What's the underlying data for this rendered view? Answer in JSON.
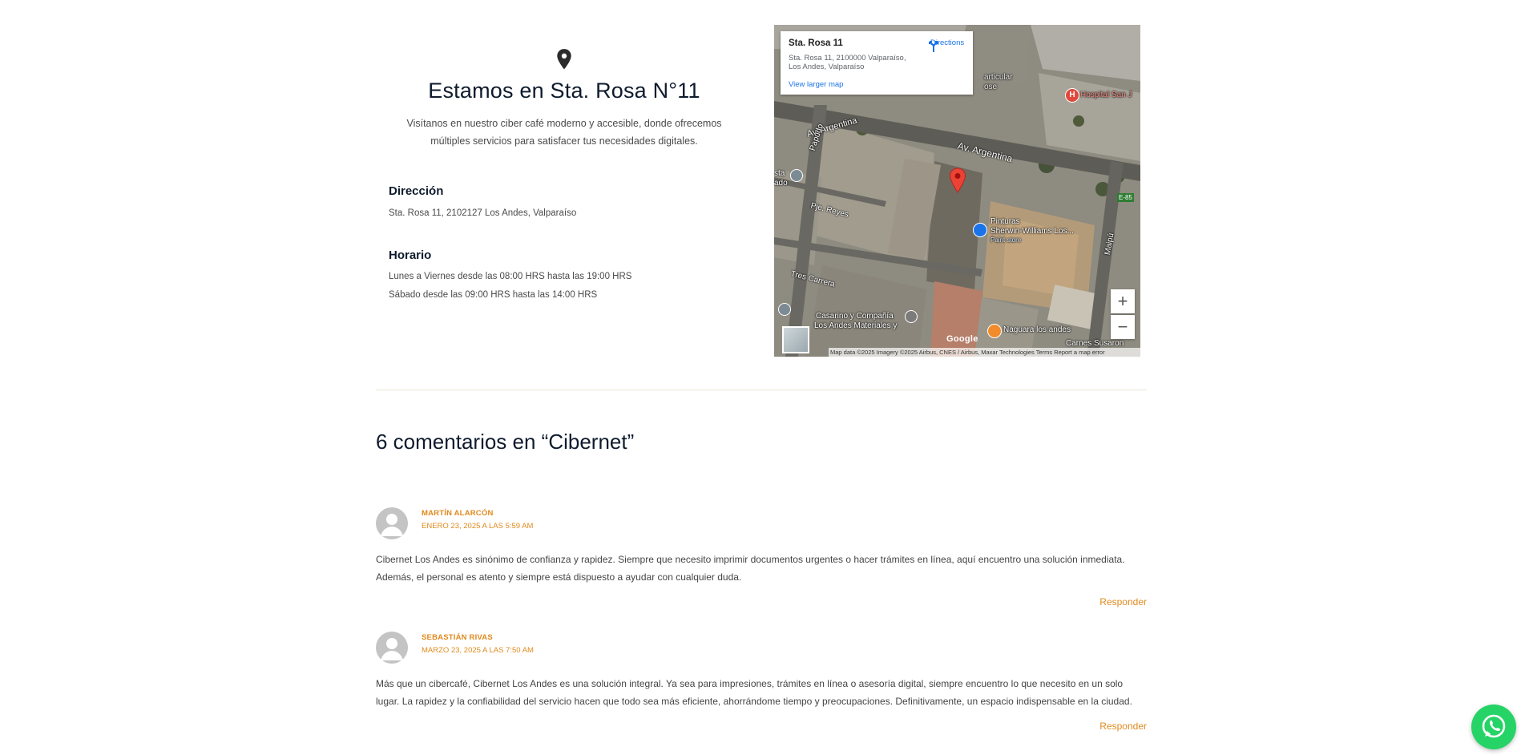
{
  "location": {
    "title": "Estamos en Sta. Rosa N°11",
    "description": "Visítanos en nuestro ciber café moderno y accesible, donde ofrecemos múltiples servicios para satisfacer tus necesidades digitales.",
    "address_heading": "Dirección",
    "address": "Sta. Rosa 11, 2102127 Los Andes, Valparaíso",
    "hours_heading": "Horario",
    "hours": [
      "Lunes a Viernes desde las 08:00 HRS hasta las 19:00 HRS",
      "Sábado desde las 09:00 HRS hasta las 14:00 HRS"
    ]
  },
  "map": {
    "place_name": "Sta. Rosa 11",
    "place_address": "Sta. Rosa 11, 2100000 Valparaíso, Los Andes, Valparaíso",
    "directions_label": "Directions",
    "larger_map_label": "View larger map",
    "zoom_in": "+",
    "zoom_out": "−",
    "google_label": "Google",
    "attribution": "Map data ©2025 Imagery ©2025 Airbus, CNES / Airbus, Maxar Technologies   Terms   Report a map error",
    "labels": {
      "street_argentina_1": "Av. Argentina",
      "street_argentina_2": "Av. Argentina",
      "street_papudo": "Papudo",
      "street_pie_reyes": "Pje. Reyes",
      "street_tres_carrera": "Tres Carrera",
      "street_maipu": "Maipú",
      "hospital": "Hospital San J",
      "particular": "articular",
      "particular_2": "ose",
      "sherwin_1": "Pinturas",
      "sherwin_2": "Sherwin-Williams Los...",
      "sherwin_3": "Paint store",
      "casarino_1": "Casarino y Compañía",
      "casarino_2": "Los Andes Materiales y",
      "naguara": "Naguara los andes",
      "carnes": "Carnes Susaron",
      "sta": "sta",
      "ado": "ado",
      "e85": "E-85"
    }
  },
  "comments_section": {
    "title": "6 comentarios en “Cibernet”",
    "reply_label": "Responder",
    "comments": [
      {
        "author": "MARTÍN ALARCÓN",
        "date": "ENERO 23, 2025 A LAS 5:59 AM",
        "text": "Cibernet Los Andes es sinónimo de confianza y rapidez. Siempre que necesito imprimir documentos urgentes o hacer trámites en línea, aquí encuentro una solución inmediata. Además, el personal es atento y siempre está dispuesto a ayudar con cualquier duda."
      },
      {
        "author": "SEBASTIÁN RIVAS",
        "date": "MARZO 23, 2025 A LAS 7:50 AM",
        "text": "Más que un cibercafé, Cibernet Los Andes es una solución integral. Ya sea para impresiones, trámites en línea o asesoría digital, siempre encuentro lo que necesito en un solo lugar. La rapidez y la confiabilidad del servicio hacen que todo sea más eficiente, ahorrándome tiempo y preocupaciones. Definitivamente, un espacio indispensable en la ciudad."
      }
    ]
  },
  "colors": {
    "accent": "#e08a1e",
    "heading": "#0f1b2d",
    "whatsapp": "#25d366"
  }
}
